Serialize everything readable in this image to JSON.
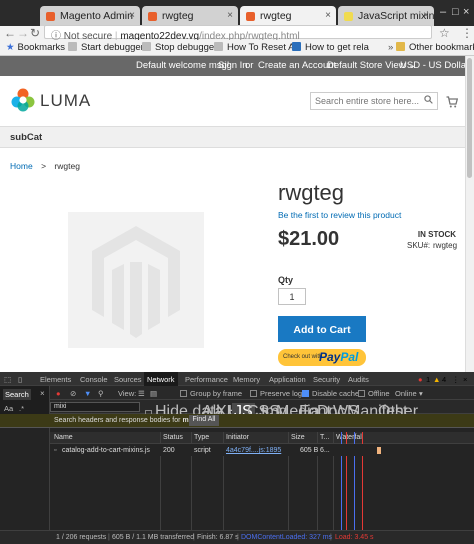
{
  "browser": {
    "tabs": [
      {
        "title": "Magento Admin",
        "icon": "magento-favicon"
      },
      {
        "title": "rwgteg",
        "icon": "magento-favicon"
      },
      {
        "title": "rwgteg",
        "icon": "magento-favicon",
        "active": true
      },
      {
        "title": "JavaScript mixins",
        "icon": "javascript-favicon"
      }
    ],
    "address": {
      "security": "Not secure",
      "host": "magento22dev.vg",
      "path": "/index.php/rwgteg.html"
    },
    "bookmarks": [
      {
        "label": "Bookmarks"
      },
      {
        "label": "Start debugger"
      },
      {
        "label": "Stop debugger"
      },
      {
        "label": "How To Reset A"
      },
      {
        "label": "How to get rela"
      },
      {
        "label": "Other bookmarks"
      }
    ]
  },
  "store": {
    "header_links": {
      "welcome": "Default welcome msg!",
      "sign_in": "Sign In",
      "or": "or",
      "create_account": "Create an Account",
      "store_switcher": "Default Store View ⌄",
      "currency": "USD - US Dollar ⌄"
    },
    "logo_text": "LUMA",
    "search_placeholder": "Search entire store here...",
    "category": "subCat",
    "breadcrumb": {
      "home": "Home",
      "separator": ">",
      "current": "rwgteg"
    },
    "product": {
      "name": "rwgteg",
      "review_link": "Be the first to review this product",
      "price": "$21.00",
      "stock": "IN STOCK",
      "sku_label": "SKU#:",
      "sku": "rwgteg",
      "qty_label": "Qty",
      "qty": "1",
      "add_to_cart": "Add to Cart",
      "paypal_small": "Check out with",
      "paypal_pay": "Pay",
      "paypal_pal": "Pal"
    }
  },
  "devtools": {
    "tabs": [
      "Elements",
      "Console",
      "Sources",
      "Network",
      "Performance",
      "Memory",
      "Application",
      "Security",
      "Audits"
    ],
    "active_tab": "Network",
    "errors": "1",
    "warnings": "4",
    "toolbar": {
      "view": "View:",
      "group_by_frame": "Group by frame",
      "preserve_log": "Preserve log",
      "disable_cache": "Disable cache",
      "offline": "Offline",
      "online": "Online"
    },
    "search": {
      "label": "Search",
      "case_toggle": "Aa",
      "regex_toggle": ".*",
      "query": "mixi",
      "scope_text_prefix": "Search headers and response bodies for",
      "scope_text_query": "mixi",
      "find_all": "Find All"
    },
    "filter": {
      "hide_data_urls": "Hide data URLs",
      "types": [
        "All",
        "XHR",
        "JS",
        "CSS",
        "Img",
        "Media",
        "Font",
        "Doc",
        "WS",
        "Manifest",
        "Other"
      ],
      "active_type": "JS"
    },
    "columns": [
      "Name",
      "Status",
      "Type",
      "Initiator",
      "Size",
      "T...",
      "Waterfall"
    ],
    "rows": [
      {
        "name": "catalog-add-to-cart-mixins.js",
        "status": "200",
        "type": "script",
        "initiator": "4a4c79f....js:1895",
        "size": "605 B",
        "time": "6..."
      }
    ],
    "status_bar": {
      "requests": "1 / 206 requests",
      "transferred": "605 B / 1.1 MB transferred",
      "finish": "Finish: 6.87 s",
      "dom_content_loaded": "DOMContentLoaded: 327 ms",
      "load": "Load: 3.45 s"
    },
    "colors": {
      "dom_line": "#4b6ff0",
      "load_line": "#e53935",
      "bar": "#f0b37e"
    }
  }
}
